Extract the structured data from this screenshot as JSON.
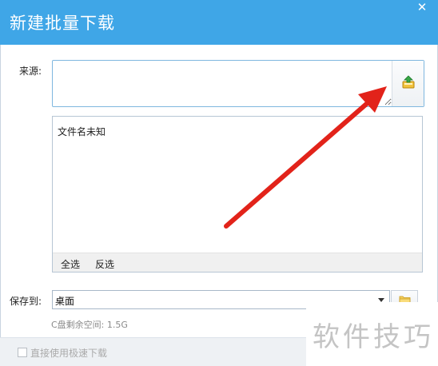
{
  "window": {
    "title": "新建批量下载",
    "close_glyph": "✕"
  },
  "source": {
    "label": "来源:",
    "value": "",
    "placeholder": ""
  },
  "file_list": {
    "items": [
      "文件名未知"
    ],
    "select_all": "全选",
    "invert_select": "反选"
  },
  "save": {
    "label": "保存到:",
    "value": "桌面",
    "free_space": "C盘剩余空间: 1.5G"
  },
  "options": {
    "direct_fast_download": "直接使用极速下载",
    "checked": false
  },
  "watermark": "软件技巧",
  "colors": {
    "titlebar": "#3fa6e7",
    "annotation_arrow": "#e2231a"
  },
  "icons": {
    "close": "close-icon",
    "upload": "upload-icon",
    "folder": "folder-icon",
    "dropdown": "chevron-down-icon"
  }
}
